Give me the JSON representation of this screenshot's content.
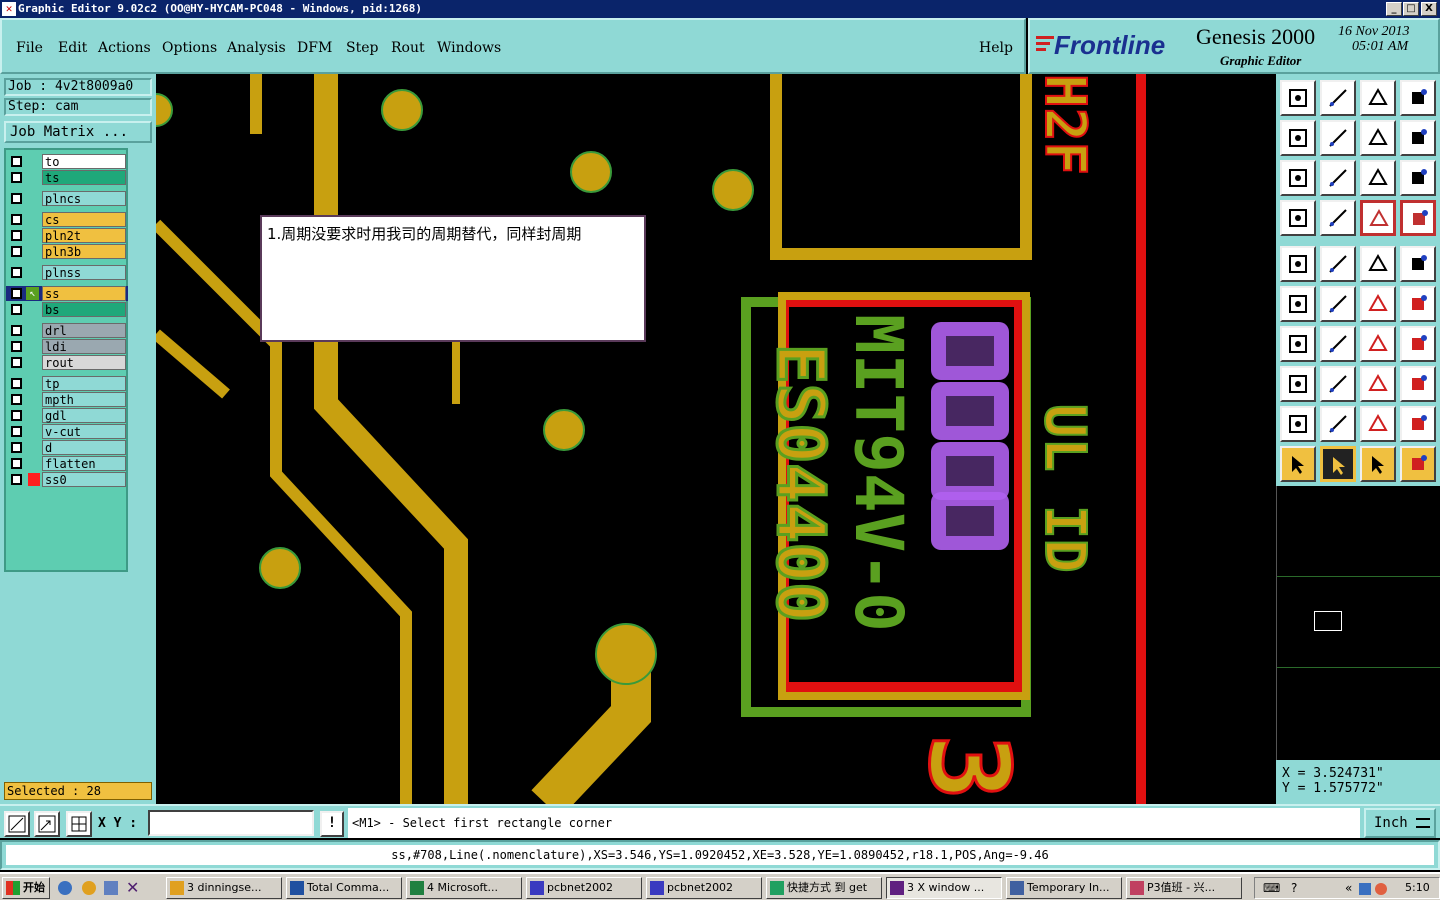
{
  "window": {
    "title": "Graphic Editor 9.02c2  (OO@HY-HYCAM-PC048 - Windows, pid:1268)",
    "buttons": [
      "_",
      "□",
      "X"
    ]
  },
  "menu": {
    "items": [
      "File",
      "Edit",
      "Actions",
      "Options",
      "Analysis",
      "DFM",
      "Step",
      "Rout",
      "Windows"
    ],
    "help": "Help"
  },
  "brand": {
    "logo": "Frontline",
    "product": "Genesis 2000",
    "subtitle": "Graphic Editor",
    "date": "16 Nov 2013",
    "time": "05:01 AM"
  },
  "job": {
    "job_label": "Job : 4v2t8009a0",
    "step_label": "Step: cam",
    "matrix_button": "Job Matrix ..."
  },
  "layers": [
    {
      "name": "to",
      "color": "#ffffff"
    },
    {
      "name": "ts",
      "color": "#1fa87a"
    },
    {
      "name": "plncs",
      "color": "#8fd9d5"
    },
    {
      "name": "cs",
      "color": "#f0c040"
    },
    {
      "name": "pln2t",
      "color": "#f0c040"
    },
    {
      "name": "pln3b",
      "color": "#f0c040"
    },
    {
      "name": "plnss",
      "color": "#8fd9d5"
    },
    {
      "name": "ss",
      "color": "#f0c040",
      "active": true
    },
    {
      "name": "bs",
      "color": "#1fa87a"
    },
    {
      "name": "drl",
      "color": "#9aa8b0"
    },
    {
      "name": "ldi",
      "color": "#9aa8b0"
    },
    {
      "name": "rout",
      "color": "#d8d8d8"
    },
    {
      "name": "tp",
      "color": "#8fd9d5"
    },
    {
      "name": "mpth",
      "color": "#8fd9d5"
    },
    {
      "name": "gdl",
      "color": "#8fd9d5"
    },
    {
      "name": "v-cut",
      "color": "#8fd9d5"
    },
    {
      "name": "d",
      "color": "#8fd9d5"
    },
    {
      "name": "flatten",
      "color": "#8fd9d5"
    },
    {
      "name": "ss0",
      "color": "#8fd9d5",
      "marker": "#ff2020"
    }
  ],
  "selected": "Selected : 28",
  "note": {
    "text": "1.周期没要求时用我司的周期替代，同样封周期"
  },
  "canvas_text": {
    "silk_line1": "ES04400",
    "silk_line2": "MIT94V-0",
    "silk_right1": "UL ID",
    "silk_right2": "H2F",
    "silk_big": "3"
  },
  "coords": {
    "x": "X = 3.524731\"",
    "y": "Y = 1.575772\""
  },
  "command": {
    "xy_label": "X Y :",
    "xy_value": "",
    "prompt": "<M1> - Select first rectangle corner",
    "units": "Inch"
  },
  "status": "ss,#708,Line(.nomenclature),XS=3.546,YS=1.0920452,XE=3.528,YE=1.0890452,r18.1,POS,Ang=-9.46",
  "taskbar": {
    "start": "开始",
    "tasks": [
      "3 dinningse...",
      "Total Comma...",
      "4 Microsoft...",
      "pcbnet2002",
      "pcbnet2002",
      "快捷方式 到 get",
      "3 X window ...",
      "Temporary In...",
      "P3值班 - 兴..."
    ],
    "clock": "5:10"
  }
}
